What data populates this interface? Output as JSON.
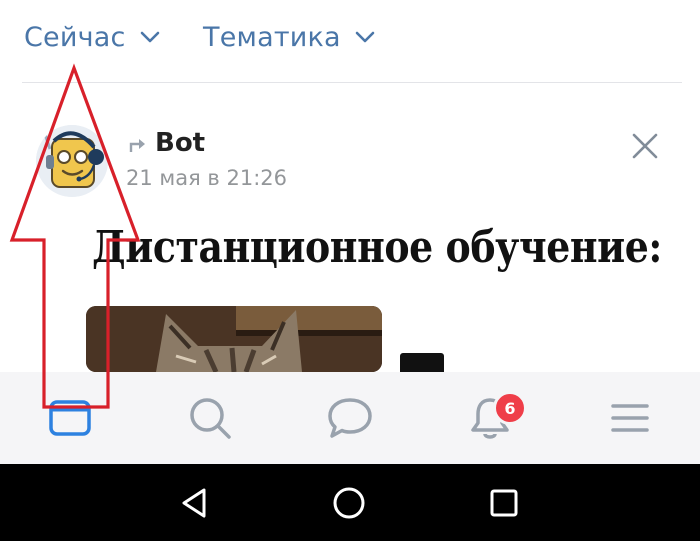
{
  "header": {
    "filter_now": {
      "label": "Сейчас",
      "icon": "chevron-down-icon"
    },
    "filter_topics": {
      "label": "Тематика",
      "icon": "chevron-down-icon"
    }
  },
  "post": {
    "author": "Bot",
    "date": "21 мая в 21:26",
    "text": "Дистанционное обучение:",
    "icons": {
      "repost": "repost-icon",
      "close": "close-icon"
    }
  },
  "bottom_nav": {
    "items": [
      {
        "name": "news",
        "icon": "newsfeed-icon",
        "active": true
      },
      {
        "name": "search",
        "icon": "search-icon"
      },
      {
        "name": "messages",
        "icon": "messages-icon"
      },
      {
        "name": "notifications",
        "icon": "bell-icon",
        "badge": "6"
      },
      {
        "name": "menu",
        "icon": "menu-icon"
      }
    ]
  },
  "system_nav": [
    "back-icon",
    "home-icon",
    "recents-icon"
  ],
  "colors": {
    "accent": "#4a76a8",
    "nav_active": "#2d81e0",
    "nav_inactive": "#99a2ad",
    "badge": "#ef3e49",
    "annotation": "#d8202a"
  }
}
